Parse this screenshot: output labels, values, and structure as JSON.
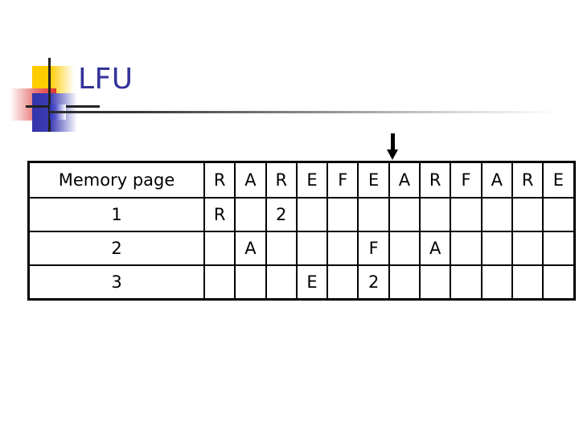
{
  "slide": {
    "title": "LFU",
    "title_color": "#333399",
    "background": "#ffffff"
  },
  "logo": {
    "name": "decorative-slide-logo",
    "yellow": "#ffcc00",
    "red": "#e03030",
    "blue": "#3333aa",
    "crosshair": "#222222"
  },
  "pointer": {
    "icon": "arrow-down-icon",
    "color": "#000000",
    "points_at_column_index": 8,
    "points_at_column_label": "A"
  },
  "table": {
    "row_label_header": "Memory page",
    "columns": [
      "R",
      "A",
      "R",
      "E",
      "F",
      "E",
      "A",
      "R",
      "F",
      "A",
      "R",
      "E"
    ],
    "colors": {
      "header": "#000000",
      "fault": "#bb66dd",
      "count": "#b22222",
      "row_label": "#000000",
      "border": "#000000"
    },
    "rows": [
      {
        "label": "1",
        "cells": [
          {
            "text": "R",
            "style": "purple"
          },
          {
            "text": "",
            "style": "black"
          },
          {
            "text": "2",
            "style": "red"
          },
          {
            "text": "",
            "style": "black"
          },
          {
            "text": "",
            "style": "black"
          },
          {
            "text": "",
            "style": "black"
          },
          {
            "text": "",
            "style": "black"
          },
          {
            "text": "",
            "style": "black"
          },
          {
            "text": "",
            "style": "black"
          },
          {
            "text": "",
            "style": "black"
          },
          {
            "text": "",
            "style": "black"
          },
          {
            "text": "",
            "style": "black"
          }
        ]
      },
      {
        "label": "2",
        "cells": [
          {
            "text": "",
            "style": "black"
          },
          {
            "text": "A",
            "style": "purple"
          },
          {
            "text": "",
            "style": "black"
          },
          {
            "text": "",
            "style": "black"
          },
          {
            "text": "",
            "style": "black"
          },
          {
            "text": "F",
            "style": "purple"
          },
          {
            "text": "",
            "style": "black"
          },
          {
            "text": "A",
            "style": "purple"
          },
          {
            "text": "",
            "style": "black"
          },
          {
            "text": "",
            "style": "black"
          },
          {
            "text": "",
            "style": "black"
          },
          {
            "text": "",
            "style": "black"
          }
        ]
      },
      {
        "label": "3",
        "cells": [
          {
            "text": "",
            "style": "black"
          },
          {
            "text": "",
            "style": "black"
          },
          {
            "text": "",
            "style": "black"
          },
          {
            "text": "E",
            "style": "purple"
          },
          {
            "text": "",
            "style": "black"
          },
          {
            "text": "2",
            "style": "red"
          },
          {
            "text": "",
            "style": "black"
          },
          {
            "text": "",
            "style": "black"
          },
          {
            "text": "",
            "style": "black"
          },
          {
            "text": "",
            "style": "black"
          },
          {
            "text": "",
            "style": "black"
          },
          {
            "text": "",
            "style": "black"
          }
        ]
      }
    ]
  }
}
